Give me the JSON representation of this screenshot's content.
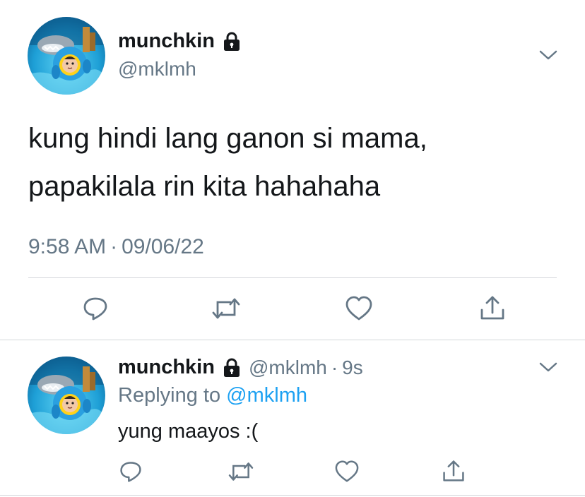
{
  "main_tweet": {
    "author_name": "munchkin",
    "author_handle": "@mklmh",
    "text_line1": "kung hindi lang ganon si mama,",
    "text_line2": "papakilala rin kita hahahaha",
    "time": "9:58 AM",
    "separator": "·",
    "date": "09/06/22"
  },
  "reply_tweet": {
    "author_name": "munchkin",
    "author_handle": "@mklmh",
    "separator": "·",
    "age": "9s",
    "replying_prefix": "Replying to",
    "replying_handle": "@mklmh",
    "text": "yung maayos :("
  },
  "icons": {
    "lock": "lock-icon",
    "chevron": "chevron-down-icon",
    "reply": "reply-icon",
    "retweet": "retweet-icon",
    "like": "like-icon",
    "share": "share-icon"
  },
  "colors": {
    "text": "#14171a",
    "muted": "#657786",
    "link": "#1da1f2",
    "divider": "#d3d6da"
  }
}
